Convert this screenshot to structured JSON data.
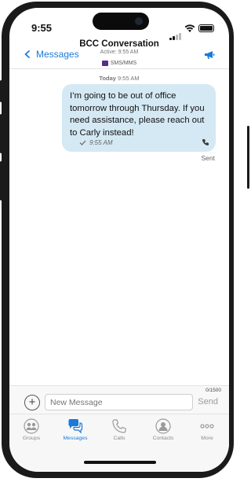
{
  "status_bar": {
    "time": "9:55"
  },
  "header": {
    "back_label": "Messages",
    "title": "BCC Conversation",
    "subtitle": "Active: 9:55 AM",
    "channel": "SMS/MMS",
    "back_icon": "chevron-left-icon",
    "action_icon": "megaphone-icon",
    "accent": "#1a7ad9"
  },
  "conversation": {
    "day_label": "Today",
    "day_time": "9:55 AM",
    "messages": [
      {
        "text": "I’m going to be out of office tomorrow through Thursday. If you need assistance, please reach out to Carly instead!",
        "time": "9:55 AM",
        "status": "Sent",
        "bubble_color": "#d4e9f4"
      }
    ]
  },
  "composer": {
    "placeholder": "New Message",
    "value": "",
    "counter": "0/1500",
    "send_label": "Send"
  },
  "tabs": [
    {
      "label": "Groups",
      "icon": "groups-icon",
      "active": false
    },
    {
      "label": "Messages",
      "icon": "chat-bubbles-icon",
      "active": true
    },
    {
      "label": "Calls",
      "icon": "phone-icon",
      "active": false
    },
    {
      "label": "Contacts",
      "icon": "contacts-icon",
      "active": false
    },
    {
      "label": "More",
      "icon": "more-dots-icon",
      "active": false
    }
  ]
}
